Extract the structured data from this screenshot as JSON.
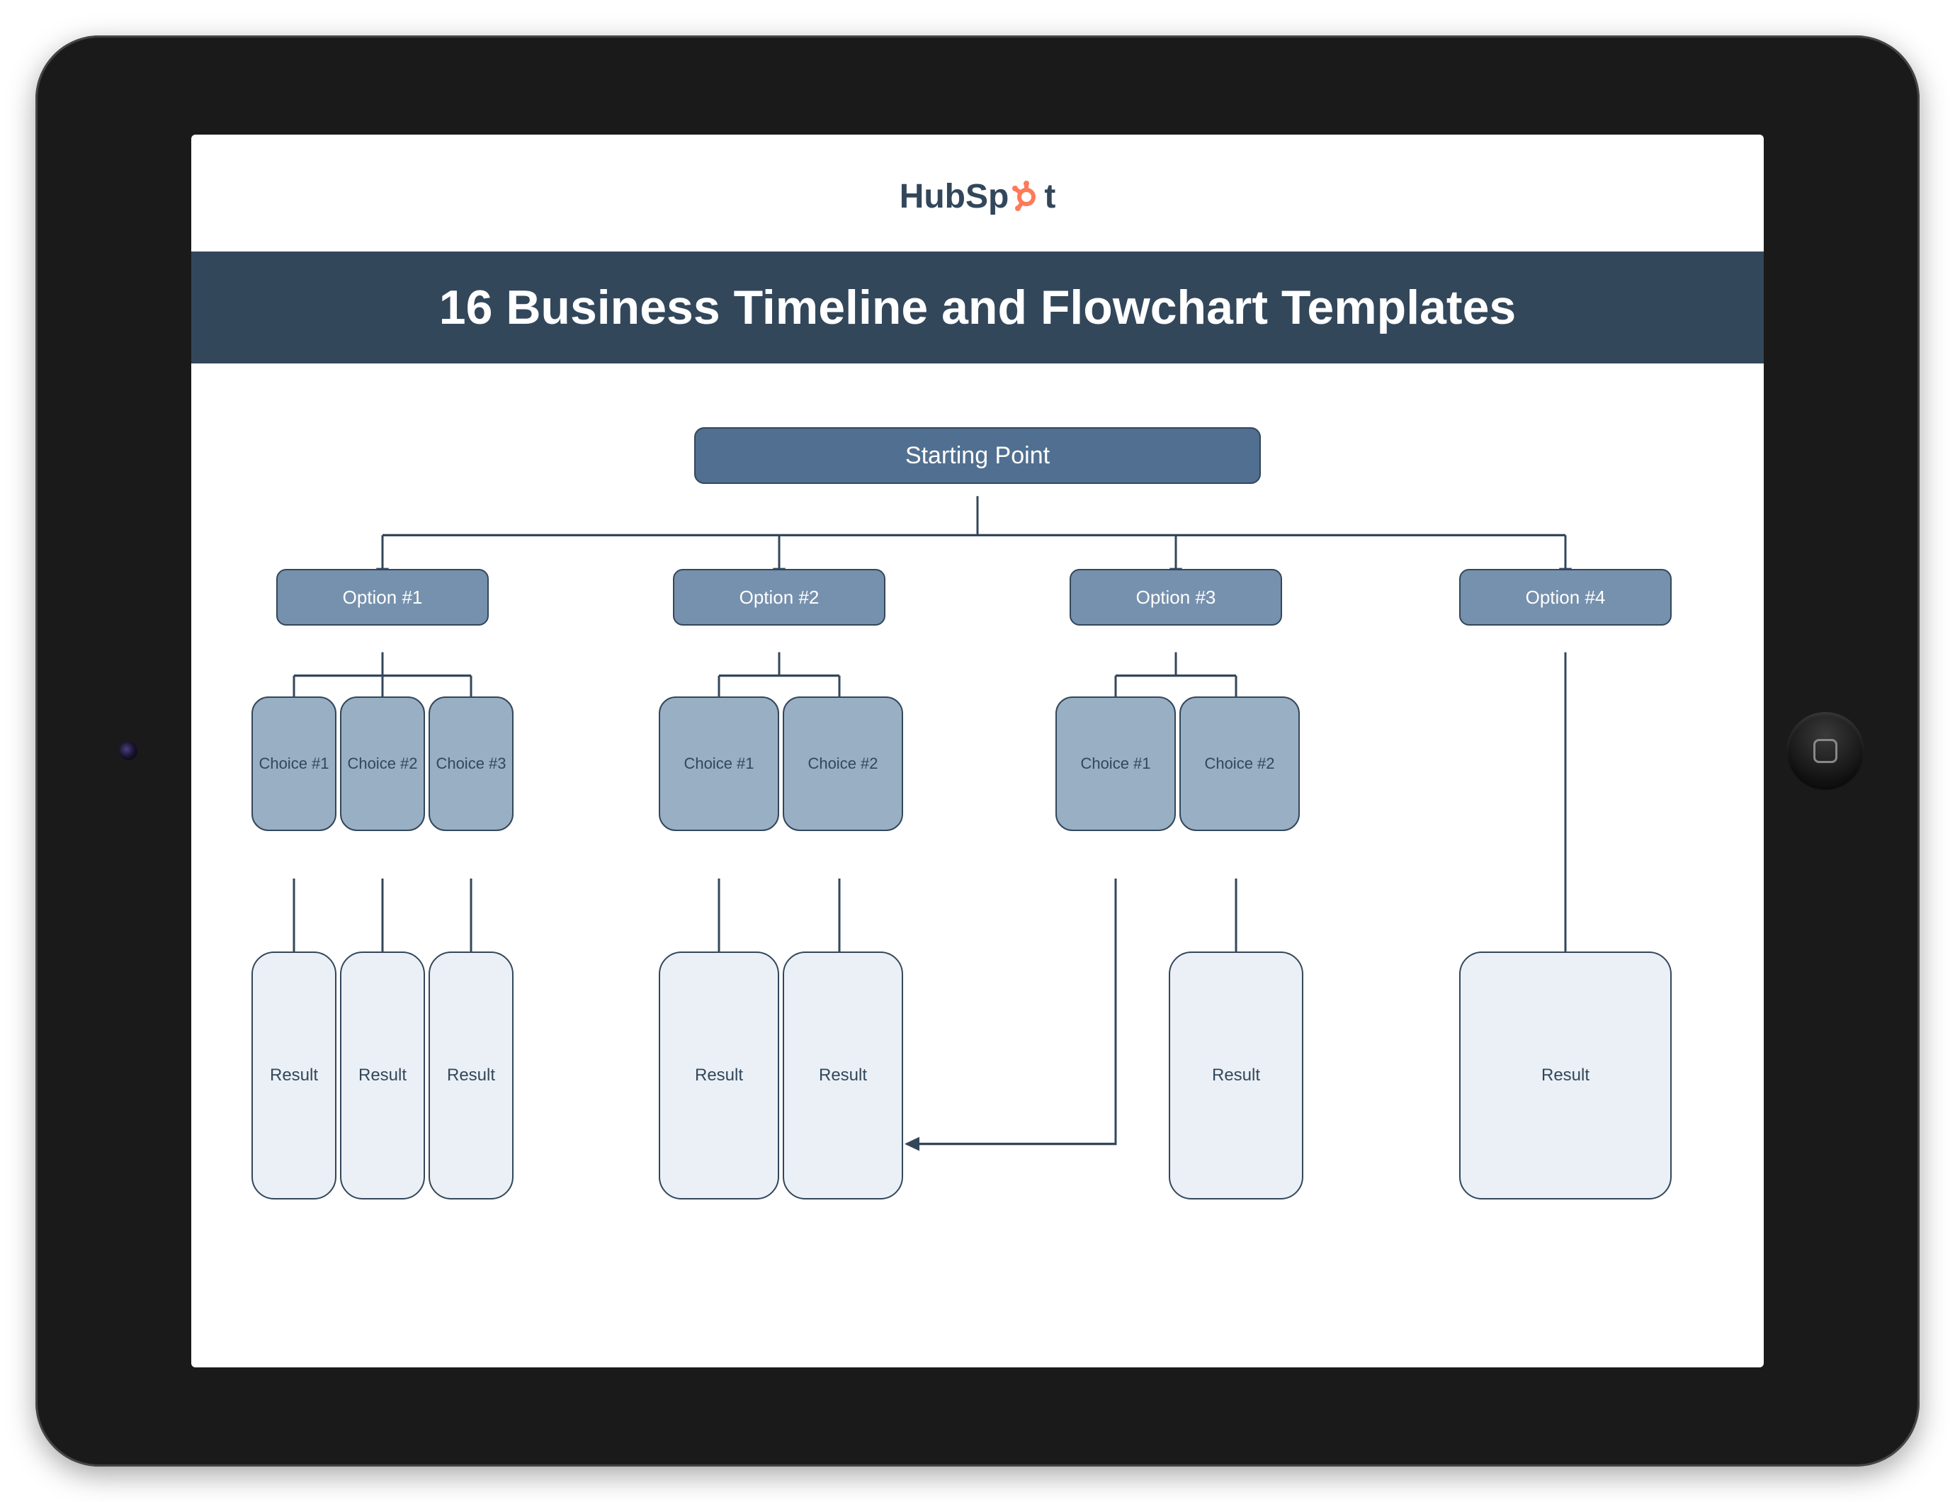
{
  "brand": {
    "name_pre": "HubSp",
    "name_post": "t",
    "accent": "#ff7a59"
  },
  "title": "16 Business Timeline and Flowchart Templates",
  "flow": {
    "start": "Starting Point",
    "options": [
      {
        "label": "Option #1",
        "choices": [
          "Choice #1",
          "Choice #2",
          "Choice #3"
        ],
        "results": [
          "Result",
          "Result",
          "Result"
        ]
      },
      {
        "label": "Option #2",
        "choices": [
          "Choice #1",
          "Choice #2"
        ],
        "results": [
          "Result",
          "Result"
        ]
      },
      {
        "label": "Option #3",
        "choices": [
          "Choice #1",
          "Choice #2"
        ],
        "results": [
          "Result"
        ]
      },
      {
        "label": "Option #4",
        "choices": [],
        "results": [
          "Result"
        ]
      }
    ]
  }
}
